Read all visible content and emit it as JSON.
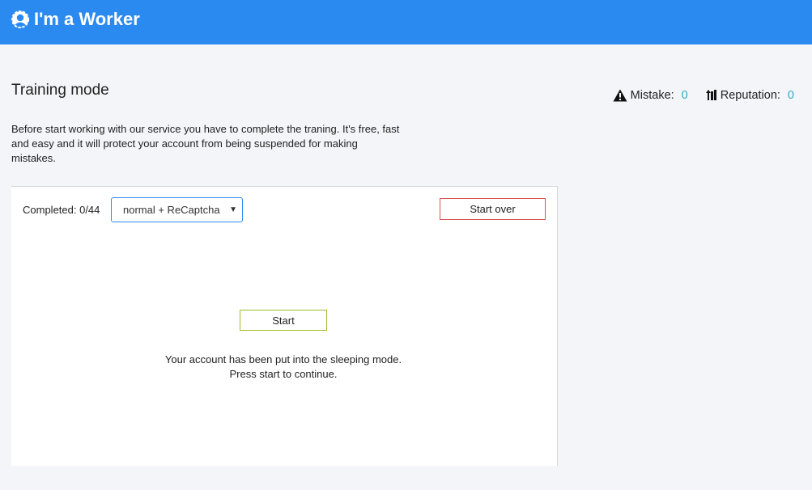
{
  "header": {
    "brand": "I'm a Worker",
    "logo_icon": "worker-logo-icon",
    "background": "#2b8af0"
  },
  "page": {
    "title": "Training mode",
    "intro": "Before start working with our service you have to complete the traning. It's free, fast and easy and it will protect your account from being suspended for making mistakes."
  },
  "stats": {
    "mistake_label": "Mistake:",
    "mistake_value": "0",
    "mistake_icon": "warning-icon",
    "reputation_label": "Reputation:",
    "reputation_value": "0",
    "reputation_icon": "reputation-icon",
    "value_color": "#30a9c4"
  },
  "panel": {
    "completed": "Completed: 0/44",
    "mode_select": {
      "selected": "normal + ReCaptcha"
    },
    "start_over_label": "Start over",
    "start_label": "Start",
    "message_line1": "Your account has been put into the sleeping mode.",
    "message_line2": "Press start to continue."
  }
}
